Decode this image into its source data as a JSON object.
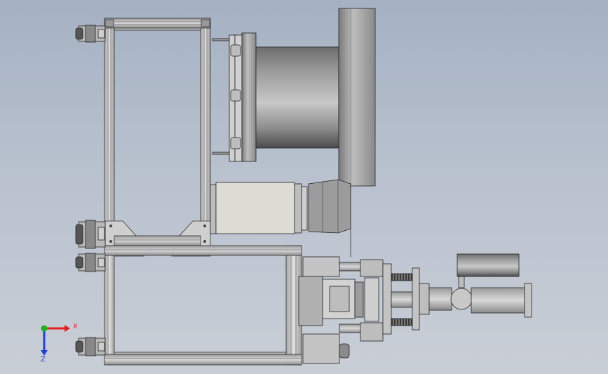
{
  "triad": {
    "x_label": "X",
    "z_label": "Z",
    "x_color": "#e02020",
    "y_color": "#18b418",
    "z_color": "#2040e0"
  },
  "colors": {
    "background_top": "#a5b1c3",
    "background_bottom": "#c9ced6",
    "frame_metal": "#d2d4d4",
    "frame_edge": "#3a3a3a",
    "cylinder_dark": "#5e5e5e",
    "cylinder_light": "#c4c4c4",
    "body_light": "#dcdcd4"
  }
}
